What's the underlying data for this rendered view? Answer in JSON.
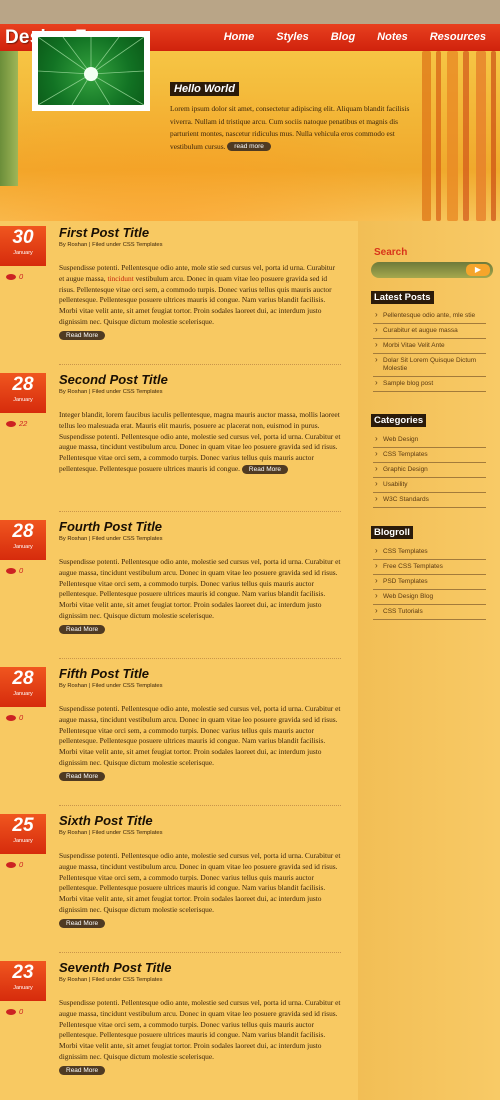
{
  "site": {
    "title": "Design Zen",
    "nav": [
      "Home",
      "Styles",
      "Blog",
      "Notes",
      "Resources"
    ]
  },
  "hero": {
    "heading": "Hello World",
    "text": "Lorem ipsum dolor sit amet, consectetur adipiscing elit. Aliquam blandit facilisis viverra. Nullam id tristique arcu. Cum sociis natoque penatibus et magnis dis parturient montes, nascetur ridiculus mus. Nulla vehicula eros commodo est vestibulum cursus.",
    "button": "read more"
  },
  "posts": [
    {
      "day": "30",
      "month": "January",
      "comments": "0",
      "title": "First Post Title",
      "meta": "By Roshan | Filed under CSS Templates",
      "body_before": "Suspendisse potenti. Pellentesque odio ante, mole stie sed cursus vel, porta id urna. Curabitur et augue massa,",
      "highlight": "tincidunt",
      "body_after": "vestibulum arcu. Donec in quam vitae leo posuere gravida sed id risus. Pellentesque vitae orci sem, a commodo turpis. Donec varius tellus quis mauris auctor pellentesque. Pellentesque posuere ultrices mauris id congue. Nam varius blandit facilisis. Morbi vitae velit ante, sit amet feugiat tortor. Proin sodales laoreet dui, ac interdum justo dignissim nec. Quisque dictum molestie scelerisque.",
      "button": "Read More"
    },
    {
      "day": "28",
      "month": "January",
      "comments": "22",
      "title": "Second Post Title",
      "meta": "By Roshan | Filed under CSS Templates",
      "body_before": "Integer blandit, lorem faucibus iaculis pellentesque, magna mauris auctor massa, mollis laoreet tellus leo malesuada erat. Mauris elit mauris, posuere ac placerat non, euismod in purus. Suspendisse potenti. Pellentesque odio ante, molestie sed cursus vel, porta id urna. Curabitur et augue massa, tincidunt vestibulum arcu. Donec in quam vitae leo posuere gravida sed id risus. Pellentesque vitae orci sem, a commodo turpis. Donec varius tellus quis mauris auctor pellentesque. Pellentesque posuere ultrices mauris id congue.",
      "highlight": "",
      "body_after": "",
      "button": "Read More"
    },
    {
      "day": "28",
      "month": "January",
      "comments": "0",
      "title": "Fourth Post Title",
      "meta": "By Roshan | Filed under CSS Templates",
      "body_before": "Suspendisse potenti. Pellentesque odio ante, molestie sed cursus vel, porta id urna. Curabitur et augue massa, tincidunt vestibulum arcu. Donec in quam vitae leo posuere gravida sed id risus. Pellentesque vitae orci sem, a commodo turpis. Donec varius tellus quis mauris auctor pellentesque. Pellentesque posuere ultrices mauris id congue. Nam varius blandit facilisis. Morbi vitae velit ante, sit amet feugiat tortor. Proin sodales laoreet dui, ac interdum justo dignissim nec. Quisque dictum molestie scelerisque.",
      "highlight": "",
      "body_after": "",
      "button": "Read More"
    },
    {
      "day": "28",
      "month": "January",
      "comments": "0",
      "title": "Fifth Post Title",
      "meta": "By Roshan | Filed under CSS Templates",
      "body_before": "Suspendisse potenti. Pellentesque odio ante, molestie sed cursus vel, porta id urna. Curabitur et augue massa, tincidunt vestibulum arcu. Donec in quam vitae leo posuere gravida sed id risus. Pellentesque vitae orci sem, a commodo turpis. Donec varius tellus quis mauris auctor pellentesque. Pellentesque posuere ultrices mauris id congue. Nam varius blandit facilisis. Morbi vitae velit ante, sit amet feugiat tortor. Proin sodales laoreet dui, ac interdum justo dignissim nec. Quisque dictum molestie scelerisque.",
      "highlight": "",
      "body_after": "",
      "button": "Read More"
    },
    {
      "day": "25",
      "month": "January",
      "comments": "0",
      "title": "Sixth Post Title",
      "meta": "By Roshan | Filed under CSS Templates",
      "body_before": "Suspendisse potenti. Pellentesque odio ante, molestie sed cursus vel, porta id urna. Curabitur et augue massa, tincidunt vestibulum arcu. Donec in quam vitae leo posuere gravida sed id risus. Pellentesque vitae orci sem, a commodo turpis. Donec varius tellus quis mauris auctor pellentesque. Pellentesque posuere ultrices mauris id congue. Nam varius blandit facilisis. Morbi vitae velit ante, sit amet feugiat tortor. Proin sodales laoreet dui, ac interdum justo dignissim nec. Quisque dictum molestie scelerisque.",
      "highlight": "",
      "body_after": "",
      "button": "Read More"
    },
    {
      "day": "23",
      "month": "January",
      "comments": "0",
      "title": "Seventh Post Title",
      "meta": "By Roshan | Filed under CSS Templates",
      "body_before": "Suspendisse potenti. Pellentesque odio ante, molestie sed cursus vel, porta id urna. Curabitur et augue massa, tincidunt vestibulum arcu. Donec in quam vitae leo posuere gravida sed id risus. Pellentesque vitae orci sem, a commodo turpis. Donec varius tellus quis mauris auctor pellentesque. Pellentesque posuere ultrices mauris id congue. Nam varius blandit facilisis. Morbi vitae velit ante, sit amet feugiat tortor. Proin sodales laoreet dui, ac interdum justo dignissim nec. Quisque dictum molestie scelerisque.",
      "highlight": "",
      "body_after": "",
      "button": "Read More"
    }
  ],
  "sidebar": {
    "search_label": "Search",
    "latest_title": "Latest Posts",
    "latest": [
      "Pellentesque odio ante, mle stie",
      "Curabitur et augue massa",
      "Morbi Vitae Velit Ante",
      "Dolar Sit Lorem Quisque Dictum Molestie",
      "Sample blog post"
    ],
    "categories_title": "Categories",
    "categories": [
      "Web Design",
      "CSS Templates",
      "Graphic Design",
      "Usability",
      "W3C Standards"
    ],
    "blogroll_title": "Blogroll",
    "blogroll": [
      "CSS Templates",
      "Free CSS Templates",
      "PSD Templates",
      "Web Design Blog",
      "CSS Tutorials"
    ]
  },
  "colors": {
    "accent": "#d8341a",
    "dark": "#2b1b0a",
    "background": "#f8c962"
  }
}
